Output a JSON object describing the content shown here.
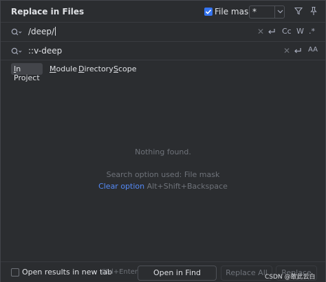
{
  "dialog": {
    "title": "Replace in Files"
  },
  "file_mask": {
    "checked": true,
    "label": "File mask:",
    "value": "*"
  },
  "search": {
    "find_value": "/deep/",
    "replace_value": "::v-deep",
    "options": {
      "match_case": "Cc",
      "whole_words": "W",
      "regex": ".*",
      "preserve_case": "AA"
    }
  },
  "scope_tabs": [
    {
      "label_underlined": "I",
      "label_rest": "n Project",
      "active": true
    },
    {
      "label_underlined": "M",
      "label_rest": "odule",
      "active": false
    },
    {
      "label_underlined": "D",
      "label_rest": "irectory",
      "active": false
    },
    {
      "label_underlined": "S",
      "label_rest": "cope",
      "active": false
    }
  ],
  "results": {
    "message": "Nothing found.",
    "search_option_text": "Search option used: File mask",
    "clear_option_link": "Clear option",
    "clear_option_shortcut": "Alt+Shift+Backspace"
  },
  "footer": {
    "open_new_tab_label": "Open results in new tab",
    "open_new_tab_checked": false,
    "find_window_shortcut": "Ctrl+Enter",
    "open_find_window_button": "Open in Find Window",
    "replace_all_button": "Replace All",
    "replace_button": "Replace"
  },
  "watermark": "CSDN @敢此云白",
  "colors": {
    "background": "#2b2d30",
    "accent": "#3574f0",
    "link": "#548af7",
    "muted_text": "#6f737a"
  }
}
